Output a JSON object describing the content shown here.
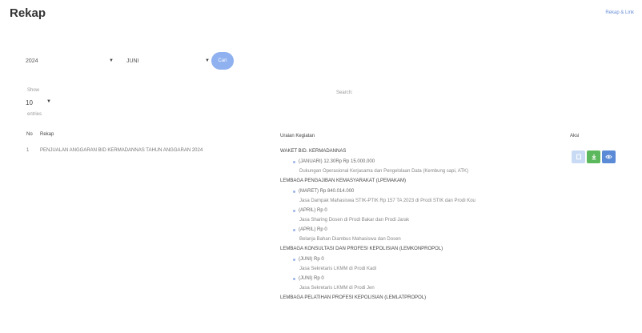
{
  "header": {
    "title": "Rekap",
    "breadcrumb": "Rekap & Link"
  },
  "filters": {
    "year": "2024",
    "month": "JUNI",
    "submit_label": "Cari"
  },
  "table_controls": {
    "show_label": "Show",
    "page_size": "10",
    "entries_label": "entries",
    "search_label": "Search:"
  },
  "table": {
    "headers": {
      "no": "No",
      "rekap": "Rekap",
      "uraian": "Uraian Kegiatan",
      "aksi": "Aksi"
    },
    "rows": [
      {
        "no": "1",
        "rekap": "PENJUALAN ANGGARAN BID KERMADANNAS TAHUN ANGGARAN 2024",
        "uraian": [
          {
            "title": "WAKET BID. KERMADANNAS",
            "items": [
              {
                "label": "(JANUARI) 12.30Rp Rp 15.000.000",
                "desc": "Dukungan Operasional Kerjasama dan Pengelolaan Data (Kembung sapi, ATK)"
              }
            ]
          },
          {
            "title": "LEMBAGA PENGAJIBAN KEMASYARAKAT (LPEMAKAM)",
            "items": [
              {
                "label": "(MARET) Rp 840.014.000",
                "desc": "Jasa Dampak Mahasiswa STIK-PTIK Rp 157 TA 2023 di Prodi STIK dan Prodi Kou"
              },
              {
                "label": "(APRIL) Rp 0",
                "desc": "Jasa Sharing Dosen di Prodi Bakar dan Prodi Jarak"
              },
              {
                "label": "(APRIL) Rp 0",
                "desc": "Belanja Bahan Diambus Mahasiswa dan Dosen"
              }
            ]
          },
          {
            "title": "LEMBAGA KONSULTASI DAN PROFESI KEPOLISIAN (LEMKONPROPOL)",
            "items": [
              {
                "label": "(JUNI) Rp 0",
                "desc": "Jasa Sekretaris LKMM di Prodi Kadi"
              },
              {
                "label": "(JUNI) Rp 0",
                "desc": "Jasa Sekretaris LKMM di Prodi Jen"
              }
            ]
          },
          {
            "title": "LEMBAGA PELATIHAN PROFESI KEPOLISIAN (LEMLATPROPOL)",
            "items": []
          }
        ]
      }
    ]
  },
  "colors": {
    "primary": "#8fb1ef",
    "edit": "#c9dbf4",
    "download": "#5cb85c",
    "view": "#5b8ad6"
  }
}
